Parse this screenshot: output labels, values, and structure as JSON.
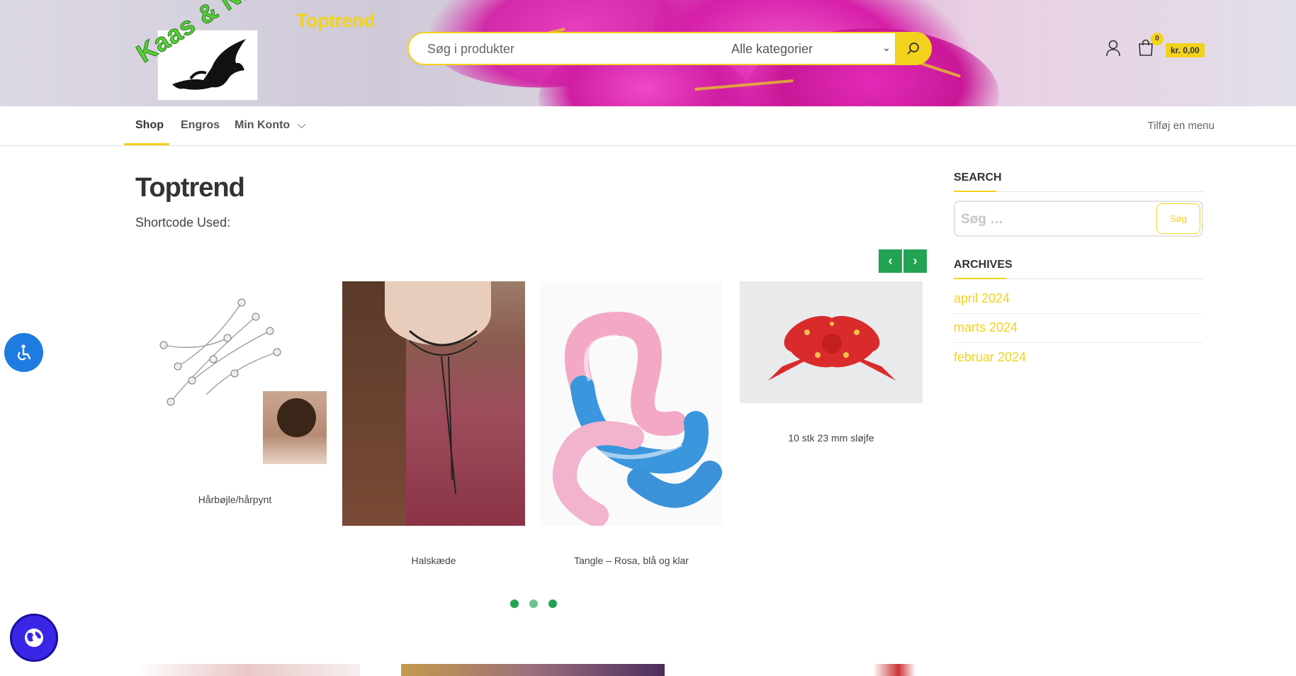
{
  "header": {
    "logo_text": "Kaas & Nielsen",
    "site_title": "Toptrend",
    "search_placeholder": "Søg i produkter",
    "category_selected": "Alle kategorier",
    "cart_count": "0",
    "cart_total": "kr. 0,00"
  },
  "nav": {
    "items": [
      {
        "label": "Shop",
        "active": true
      },
      {
        "label": "Engros"
      },
      {
        "label": "Min Konto"
      }
    ],
    "right_link": "Tilføj en menu"
  },
  "main": {
    "title": "Toptrend",
    "shortcode": "Shortcode Used:",
    "products": [
      {
        "name": "Hårbøjle/hårpynt"
      },
      {
        "name": "Halskæde"
      },
      {
        "name": "Tangle – Rosa, blå og klar"
      },
      {
        "name": "10 stk 23 mm sløjfe"
      }
    ],
    "carousel_pages": 3
  },
  "sidebar": {
    "search_title": "SEARCH",
    "search_placeholder": "Søg …",
    "search_button": "Søg",
    "archives_title": "ARCHIVES",
    "archives": [
      "april 2024",
      "marts 2024",
      "februar 2024"
    ]
  },
  "colors": {
    "accent_yellow": "#f3d21c",
    "accent_green": "#21a353",
    "a11y_blue": "#1e7be0",
    "globe_purple": "#3a27e6"
  },
  "icons": [
    "search-icon",
    "user-icon",
    "cart-icon",
    "chevron-down-icon",
    "chevron-left-icon",
    "chevron-right-icon",
    "accessibility-icon",
    "globe-icon"
  ]
}
